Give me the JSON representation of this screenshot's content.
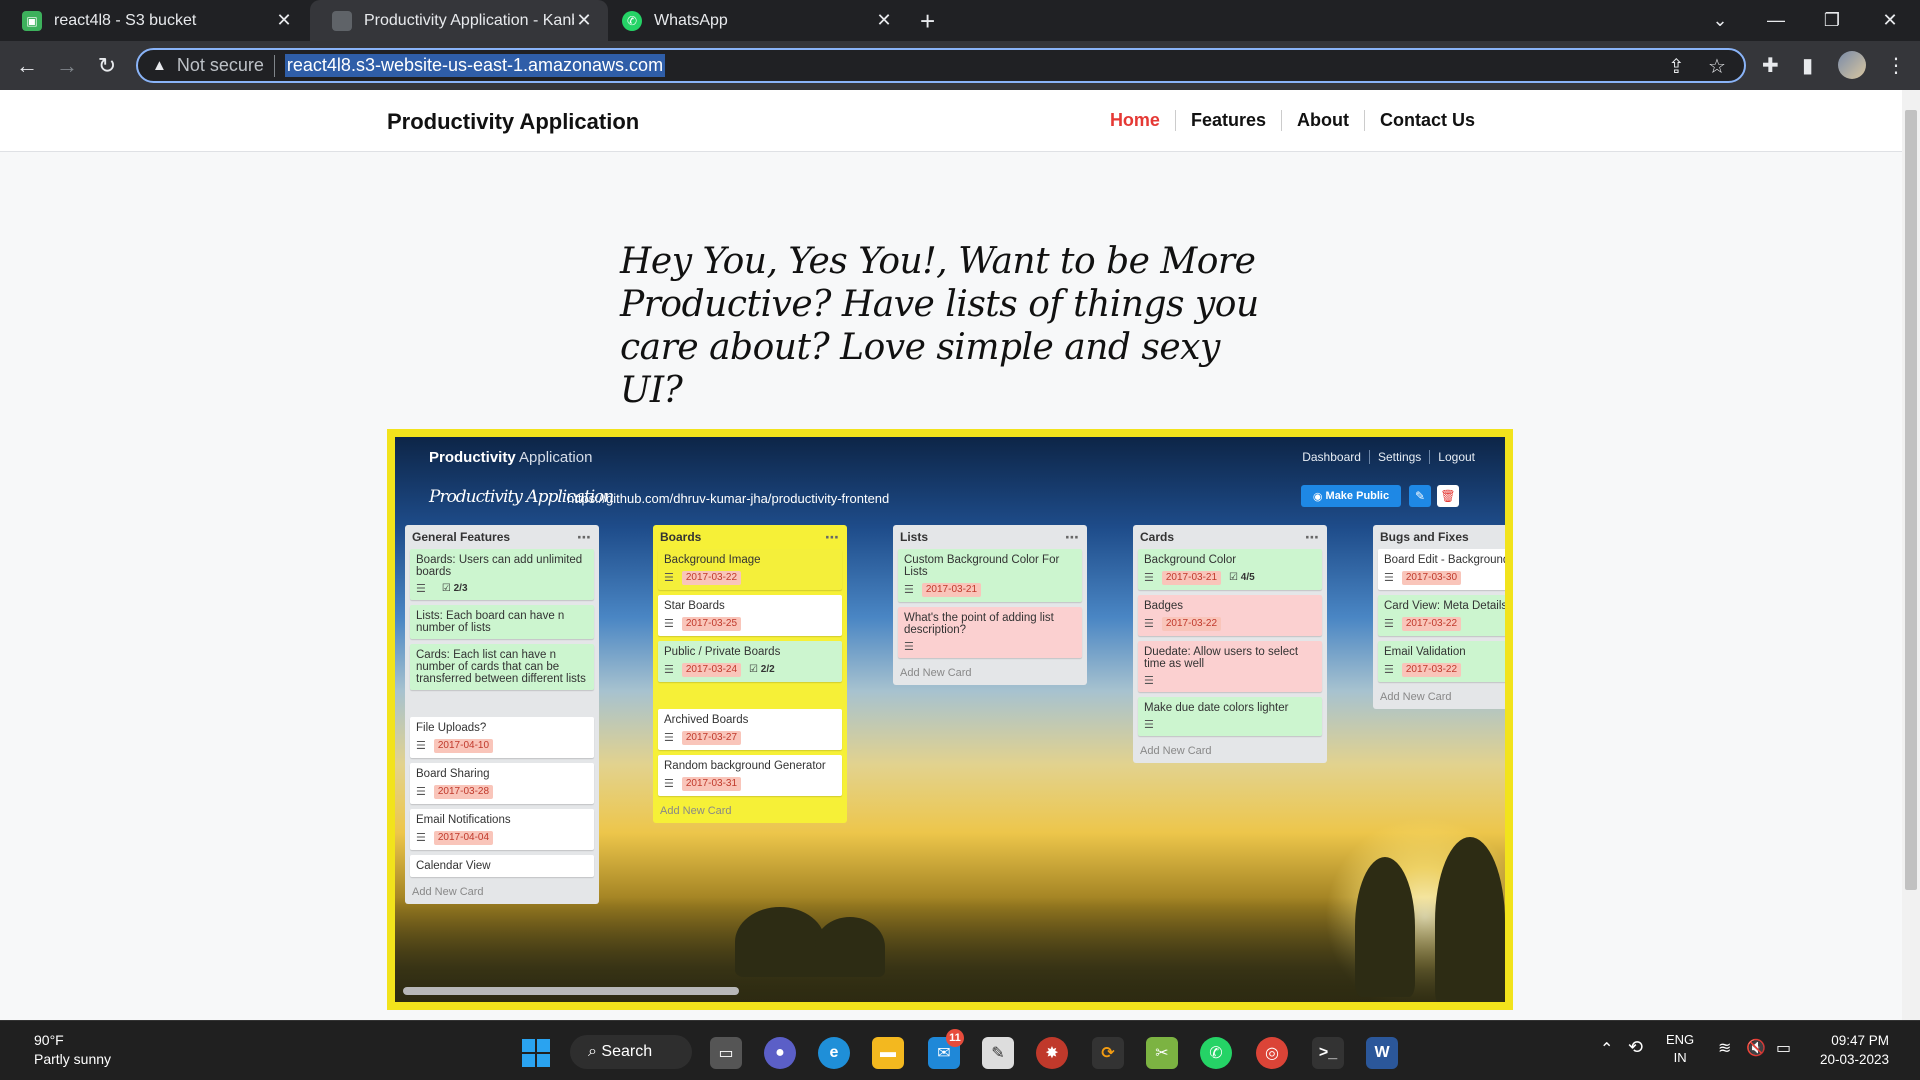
{
  "browser": {
    "tabs": [
      {
        "title": "react4l8 - S3 bucket",
        "active": false
      },
      {
        "title": "Productivity Application - Kanban",
        "active": true
      },
      {
        "title": "WhatsApp",
        "active": false
      }
    ],
    "security_label": "Not secure",
    "url": "react4l8.s3-website-us-east-1.amazonaws.com"
  },
  "site": {
    "brand": "Productivity Application",
    "nav": [
      "Home",
      "Features",
      "About",
      "Contact Us"
    ],
    "hero_text": "Hey You, Yes You!, Want to be More Productive? Have lists of things you care about? Love simple and sexy UI?"
  },
  "preview": {
    "brand_bold": "Productivity",
    "brand_rest": " Application",
    "menu": [
      "Dashboard",
      "Settings",
      "Logout"
    ],
    "board_title": "Productivity Application",
    "board_link": "https://github.com/dhruv-kumar-jha/productivity-frontend",
    "make_public": "Make Public",
    "add_new_card": "Add New Card",
    "lists": [
      {
        "title": "General Features",
        "cards": [
          {
            "text": "Boards: Users can add unlimited boards",
            "color": "green",
            "check": "2/3"
          },
          {
            "text": "Lists: Each board can have n number of lists",
            "color": "green"
          },
          {
            "text": "Cards: Each list can have n number of cards that can be transferred between different lists",
            "color": "green"
          },
          {
            "text": "",
            "color": "spacer"
          },
          {
            "text": "File Uploads?",
            "color": "white",
            "date": "2017-04-10"
          },
          {
            "text": "Board Sharing",
            "color": "white",
            "date": "2017-03-28"
          },
          {
            "text": "Email Notifications",
            "color": "white",
            "date": "2017-04-04"
          },
          {
            "text": "Calendar View",
            "color": "white"
          }
        ]
      },
      {
        "title": "Boards",
        "cards": [
          {
            "text": "Background Image",
            "color": "yellow",
            "date": "2017-03-22"
          },
          {
            "text": "Star Boards",
            "color": "white",
            "date": "2017-03-25"
          },
          {
            "text": "Public / Private Boards",
            "color": "green",
            "date": "2017-03-24",
            "check": "2/2"
          },
          {
            "text": "",
            "color": "spacer"
          },
          {
            "text": "Archived Boards",
            "color": "white",
            "date": "2017-03-27"
          },
          {
            "text": "Random background Generator",
            "color": "white",
            "date": "2017-03-31"
          }
        ]
      },
      {
        "title": "Lists",
        "cards": [
          {
            "text": "Custom Background Color For Lists",
            "color": "green",
            "date": "2017-03-21"
          },
          {
            "text": "What's the point of adding list description?",
            "color": "red",
            "lines_only": true
          }
        ]
      },
      {
        "title": "Cards",
        "cards": [
          {
            "text": "Background Color",
            "color": "green",
            "date": "2017-03-21",
            "check": "4/5"
          },
          {
            "text": "Badges",
            "color": "red",
            "date": "2017-03-22"
          },
          {
            "text": "Duedate: Allow users to select time as well",
            "color": "red",
            "lines_only": true
          },
          {
            "text": "Make due date colors lighter",
            "color": "green",
            "lines_only": true
          }
        ]
      },
      {
        "title": "Bugs and Fixes",
        "cards": [
          {
            "text": "Board Edit - Background Warning",
            "color": "white",
            "date": "2017-03-30"
          },
          {
            "text": "Card View: Meta Details",
            "color": "green",
            "date": "2017-03-22"
          },
          {
            "text": "Email Validation",
            "color": "green",
            "date": "2017-03-22"
          }
        ]
      }
    ]
  },
  "taskbar": {
    "temperature": "90°F",
    "weather": "Partly sunny",
    "search_label": "Search",
    "mail_badge": "11",
    "lang_top": "ENG",
    "lang_bottom": "IN",
    "time": "09:47 PM",
    "date": "20-03-2023"
  }
}
